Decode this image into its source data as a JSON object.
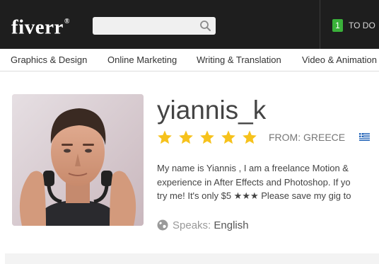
{
  "header": {
    "logo": "fiverr",
    "logo_mark": "®",
    "search": {
      "value": "",
      "placeholder": "",
      "icon": "search-icon"
    },
    "todo": {
      "count": "1",
      "label": "TO DO",
      "badge_color": "#3ab13a"
    }
  },
  "categories": [
    "Graphics & Design",
    "Online Marketing",
    "Writing & Translation",
    "Video & Animation"
  ],
  "profile": {
    "username": "yiannis_k",
    "rating": 5,
    "rating_max": 5,
    "from_label": "FROM: GREECE",
    "flag": "greece-flag-icon",
    "bio_lines": [
      "My name is Yiannis , I am a freelance Motion &",
      "experience in After Effects and Photoshop. If yo",
      "try me! It's only $5 ★★★ Please save my gig to"
    ],
    "speaks_label": "Speaks:",
    "speaks_value": "English"
  },
  "colors": {
    "topbar": "#1e1e1e",
    "star": "#f6c21c",
    "text": "#444444"
  }
}
